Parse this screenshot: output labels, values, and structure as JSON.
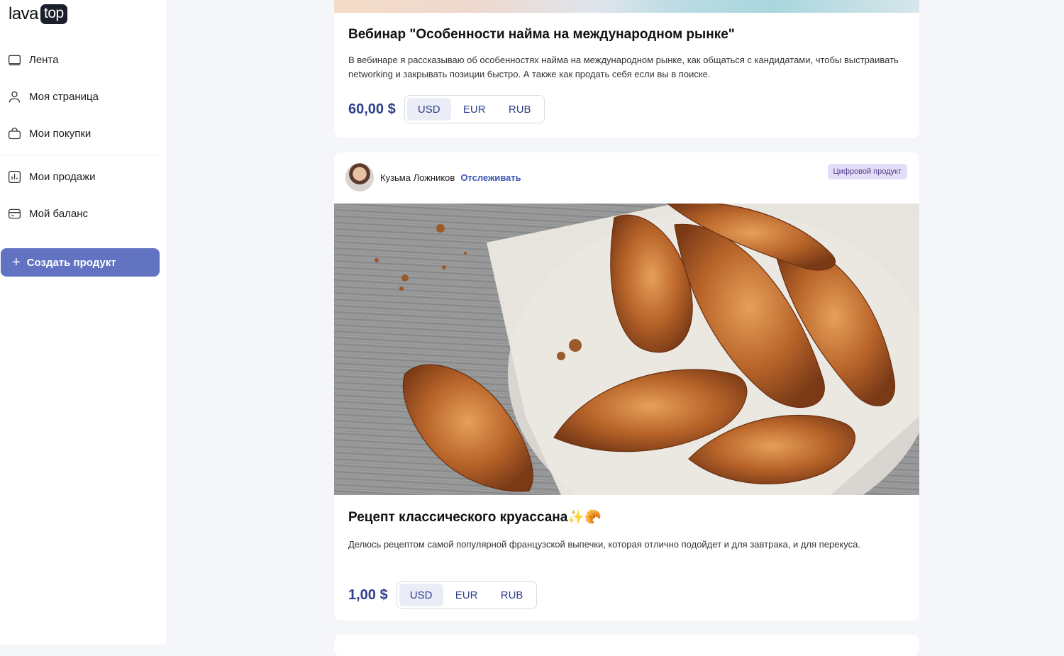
{
  "logo": {
    "word": "lava",
    "badge": "top"
  },
  "nav": {
    "items": [
      {
        "label": "Лента",
        "icon": "feed-icon"
      },
      {
        "label": "Моя страница",
        "icon": "user-icon"
      },
      {
        "label": "Мои покупки",
        "icon": "bag-icon"
      },
      {
        "label": "Мои продажи",
        "icon": "chart-icon"
      },
      {
        "label": "Мой баланс",
        "icon": "card-icon"
      }
    ],
    "create_button": "Создать продукт"
  },
  "posts": [
    {
      "title": "Вебинар \"Особенности найма на международном рынке\"",
      "description": "В вебинаре я рассказываю об особенностях найма на международном рынке, как общаться с кандидатами, чтобы выстраивать networking и закрывать позиции быстро. А также как продать себя если вы в поиске.",
      "price": "60,00 $",
      "currencies": [
        "USD",
        "EUR",
        "RUB"
      ],
      "active_currency": "USD"
    },
    {
      "author": "Кузьма Ложников",
      "follow": "Отслеживать",
      "tag": "Цифровой продукт",
      "title": "Рецепт классического круассана✨🥐",
      "description": "Делюсь рецептом самой популярной французской выпечки, которая отлично подойдет и для завтрака, и для перекуса.",
      "price": "1,00 $",
      "currencies": [
        "USD",
        "EUR",
        "RUB"
      ],
      "active_currency": "USD"
    }
  ],
  "colors": {
    "accent": "#6173c1",
    "link": "#3c57b2",
    "price": "#2d3f8f",
    "tag_bg": "#e4ddf7"
  }
}
